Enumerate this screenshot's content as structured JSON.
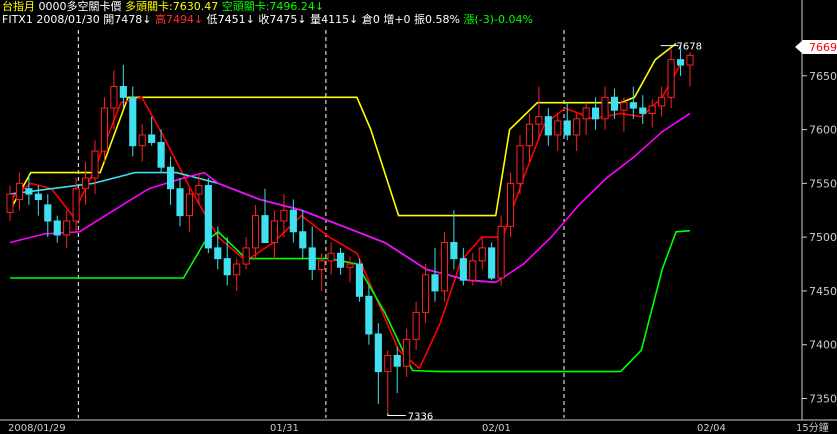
{
  "header": {
    "line1": [
      {
        "text": "台指月",
        "color": "#ffff00",
        "name": "header-contract"
      },
      {
        "text": "0000多空關卡價",
        "color": "#ffffff",
        "name": "header-indicator-name"
      },
      {
        "text": "多頭關卡:7630.47",
        "color": "#ffff00",
        "name": "header-bull-level"
      },
      {
        "text": "空頭關卡:7496.24↓",
        "color": "#00ff00",
        "name": "header-bear-level"
      }
    ],
    "line2": [
      {
        "text": "FITX1",
        "color": "#ffffff",
        "name": "header-symbol"
      },
      {
        "text": "2008/01/30",
        "color": "#ffffff",
        "name": "header-date"
      },
      {
        "text": "開7478↓",
        "color": "#ffffff",
        "name": "header-open"
      },
      {
        "text": "高7494↓",
        "color": "#ff3030",
        "name": "header-high"
      },
      {
        "text": "低7451↓",
        "color": "#ffffff",
        "name": "header-low"
      },
      {
        "text": "收7475↓",
        "color": "#ffffff",
        "name": "header-close"
      },
      {
        "text": "量4115↓",
        "color": "#ffffff",
        "name": "header-volume"
      },
      {
        "text": "倉0",
        "color": "#ffffff",
        "name": "header-oi"
      },
      {
        "text": "增+0",
        "color": "#ffffff",
        "name": "header-oi-change"
      },
      {
        "text": "振0.58%",
        "color": "#ffffff",
        "name": "header-amplitude"
      },
      {
        "text": "漲(-3)-0.04%",
        "color": "#00ff00",
        "name": "header-change"
      }
    ]
  },
  "price_tag": "7669",
  "footer": {
    "dates": [
      "2008/01/29",
      "01/31",
      "02/01",
      "02/04"
    ],
    "period": "15分鐘"
  },
  "colors": {
    "background": "#000000",
    "axis": "#cccccc",
    "up_candle": "#ff2020",
    "down_candle": "#40e0f0",
    "yellow_line": "#ffff00",
    "red_line": "#ff0000",
    "cyan_line": "#40e0f0",
    "magenta_line": "#ff00ff",
    "green_line": "#00ff00"
  },
  "chart_data": {
    "type": "candlestick",
    "interval": "15分鐘",
    "ylim": [
      7330,
      7700
    ],
    "y_ticks": [
      7650,
      7600,
      7550,
      7500,
      7450,
      7400,
      7350
    ],
    "x_labels": [
      "2008/01/29",
      "01/31",
      "02/01",
      "02/04"
    ],
    "annotations": [
      {
        "label": "7336",
        "value": 7336
      },
      {
        "label": "7678",
        "value": 7678
      }
    ],
    "current_price": 7669,
    "candles": [
      [
        7523,
        7548,
        7515,
        7540
      ],
      [
        7535,
        7560,
        7525,
        7550
      ],
      [
        7545,
        7558,
        7530,
        7540
      ],
      [
        7540,
        7548,
        7520,
        7535
      ],
      [
        7530,
        7540,
        7500,
        7515
      ],
      [
        7515,
        7520,
        7495,
        7502
      ],
      [
        7502,
        7525,
        7490,
        7515
      ],
      [
        7515,
        7555,
        7505,
        7545
      ],
      [
        7545,
        7570,
        7530,
        7555
      ],
      [
        7555,
        7590,
        7540,
        7580
      ],
      [
        7580,
        7630,
        7570,
        7620
      ],
      [
        7620,
        7655,
        7600,
        7640
      ],
      [
        7640,
        7660,
        7620,
        7630
      ],
      [
        7630,
        7640,
        7575,
        7585
      ],
      [
        7585,
        7605,
        7570,
        7595
      ],
      [
        7595,
        7612,
        7585,
        7588
      ],
      [
        7588,
        7600,
        7560,
        7565
      ],
      [
        7565,
        7575,
        7530,
        7545
      ],
      [
        7545,
        7555,
        7510,
        7520
      ],
      [
        7520,
        7545,
        7505,
        7540
      ],
      [
        7540,
        7560,
        7530,
        7548
      ],
      [
        7548,
        7555,
        7485,
        7490
      ],
      [
        7490,
        7510,
        7470,
        7480
      ],
      [
        7480,
        7500,
        7455,
        7465
      ],
      [
        7465,
        7480,
        7450,
        7475
      ],
      [
        7475,
        7500,
        7470,
        7490
      ],
      [
        7490,
        7530,
        7480,
        7520
      ],
      [
        7520,
        7545,
        7505,
        7495
      ],
      [
        7495,
        7525,
        7480,
        7515
      ],
      [
        7515,
        7540,
        7500,
        7525
      ],
      [
        7525,
        7535,
        7495,
        7505
      ],
      [
        7505,
        7525,
        7480,
        7490
      ],
      [
        7490,
        7510,
        7460,
        7470
      ],
      [
        7470,
        7485,
        7450,
        7478
      ],
      [
        7478,
        7495,
        7465,
        7485
      ],
      [
        7485,
        7490,
        7465,
        7472
      ],
      [
        7472,
        7482,
        7458,
        7475
      ],
      [
        7475,
        7480,
        7440,
        7445
      ],
      [
        7445,
        7455,
        7400,
        7410
      ],
      [
        7410,
        7420,
        7345,
        7375
      ],
      [
        7375,
        7395,
        7336,
        7390
      ],
      [
        7390,
        7398,
        7355,
        7380
      ],
      [
        7380,
        7415,
        7370,
        7405
      ],
      [
        7405,
        7440,
        7395,
        7430
      ],
      [
        7430,
        7475,
        7420,
        7465
      ],
      [
        7465,
        7490,
        7440,
        7450
      ],
      [
        7450,
        7505,
        7440,
        7495
      ],
      [
        7495,
        7525,
        7470,
        7480
      ],
      [
        7480,
        7490,
        7455,
        7460
      ],
      [
        7460,
        7485,
        7455,
        7478
      ],
      [
        7478,
        7500,
        7470,
        7490
      ],
      [
        7490,
        7495,
        7460,
        7462
      ],
      [
        7462,
        7520,
        7455,
        7510
      ],
      [
        7510,
        7560,
        7500,
        7550
      ],
      [
        7550,
        7595,
        7540,
        7585
      ],
      [
        7585,
        7615,
        7570,
        7605
      ],
      [
        7605,
        7640,
        7590,
        7612
      ],
      [
        7612,
        7620,
        7585,
        7595
      ],
      [
        7595,
        7615,
        7580,
        7608
      ],
      [
        7608,
        7625,
        7590,
        7595
      ],
      [
        7595,
        7615,
        7580,
        7610
      ],
      [
        7610,
        7625,
        7595,
        7620
      ],
      [
        7620,
        7630,
        7600,
        7610
      ],
      [
        7610,
        7640,
        7600,
        7630
      ],
      [
        7630,
        7638,
        7610,
        7618
      ],
      [
        7618,
        7630,
        7598,
        7625
      ],
      [
        7625,
        7640,
        7610,
        7620
      ],
      [
        7620,
        7632,
        7605,
        7615
      ],
      [
        7615,
        7628,
        7602,
        7622
      ],
      [
        7622,
        7640,
        7612,
        7630
      ],
      [
        7630,
        7675,
        7620,
        7665
      ],
      [
        7665,
        7678,
        7650,
        7660
      ],
      [
        7660,
        7672,
        7640,
        7669
      ]
    ],
    "series": [
      {
        "color": "yellow",
        "points": [
          [
            0,
            7525
          ],
          [
            3,
            7560
          ],
          [
            13,
            7560
          ],
          [
            17,
            7630
          ],
          [
            50,
            7630
          ],
          [
            52,
            7600
          ],
          [
            56,
            7520
          ],
          [
            60,
            7520
          ],
          [
            70,
            7520
          ],
          [
            72,
            7600
          ],
          [
            76,
            7625
          ],
          [
            88,
            7625
          ],
          [
            90,
            7630
          ],
          [
            93,
            7665
          ],
          [
            96,
            7680
          ]
        ]
      },
      {
        "color": "red",
        "points": [
          [
            0,
            7535
          ],
          [
            3,
            7550
          ],
          [
            6,
            7545
          ],
          [
            9,
            7520
          ],
          [
            12,
            7560
          ],
          [
            16,
            7625
          ],
          [
            19,
            7630
          ],
          [
            22,
            7595
          ],
          [
            26,
            7545
          ],
          [
            30,
            7500
          ],
          [
            34,
            7478
          ],
          [
            38,
            7495
          ],
          [
            42,
            7520
          ],
          [
            46,
            7500
          ],
          [
            50,
            7485
          ],
          [
            53,
            7440
          ],
          [
            56,
            7395
          ],
          [
            59,
            7378
          ],
          [
            62,
            7420
          ],
          [
            65,
            7478
          ],
          [
            68,
            7500
          ],
          [
            71,
            7500
          ],
          [
            74,
            7555
          ],
          [
            77,
            7605
          ],
          [
            80,
            7620
          ],
          [
            84,
            7610
          ],
          [
            88,
            7615
          ],
          [
            91,
            7612
          ],
          [
            94,
            7630
          ],
          [
            97,
            7665
          ]
        ]
      },
      {
        "color": "cyan",
        "points": [
          [
            0,
            7540
          ],
          [
            6,
            7545
          ],
          [
            12,
            7550
          ],
          [
            18,
            7560
          ],
          [
            24,
            7560
          ],
          [
            30,
            7550
          ],
          [
            36,
            7535
          ],
          [
            42,
            7525
          ],
          [
            48,
            7510
          ],
          [
            54,
            7495
          ],
          [
            60,
            7470
          ],
          [
            66,
            7460
          ],
          [
            70,
            7458
          ]
        ]
      },
      {
        "color": "magenta",
        "points": [
          [
            0,
            7495
          ],
          [
            5,
            7503
          ],
          [
            10,
            7505
          ],
          [
            15,
            7525
          ],
          [
            20,
            7545
          ],
          [
            25,
            7555
          ],
          [
            28,
            7560
          ],
          [
            30,
            7550
          ],
          [
            36,
            7535
          ],
          [
            42,
            7525
          ],
          [
            48,
            7510
          ],
          [
            54,
            7495
          ],
          [
            60,
            7470
          ],
          [
            66,
            7460
          ],
          [
            70,
            7458
          ],
          [
            74,
            7475
          ],
          [
            78,
            7500
          ],
          [
            82,
            7530
          ],
          [
            86,
            7555
          ],
          [
            90,
            7575
          ],
          [
            94,
            7598
          ],
          [
            98,
            7615
          ]
        ]
      },
      {
        "color": "green",
        "points": [
          [
            0,
            7462
          ],
          [
            20,
            7462
          ],
          [
            25,
            7462
          ],
          [
            28,
            7495
          ],
          [
            30,
            7505
          ],
          [
            34,
            7480
          ],
          [
            46,
            7480
          ],
          [
            50,
            7475
          ],
          [
            54,
            7430
          ],
          [
            58,
            7376
          ],
          [
            62,
            7375
          ],
          [
            84,
            7375
          ],
          [
            88,
            7375
          ],
          [
            91,
            7395
          ],
          [
            94,
            7470
          ],
          [
            96,
            7505
          ],
          [
            98,
            7506
          ]
        ]
      }
    ]
  }
}
